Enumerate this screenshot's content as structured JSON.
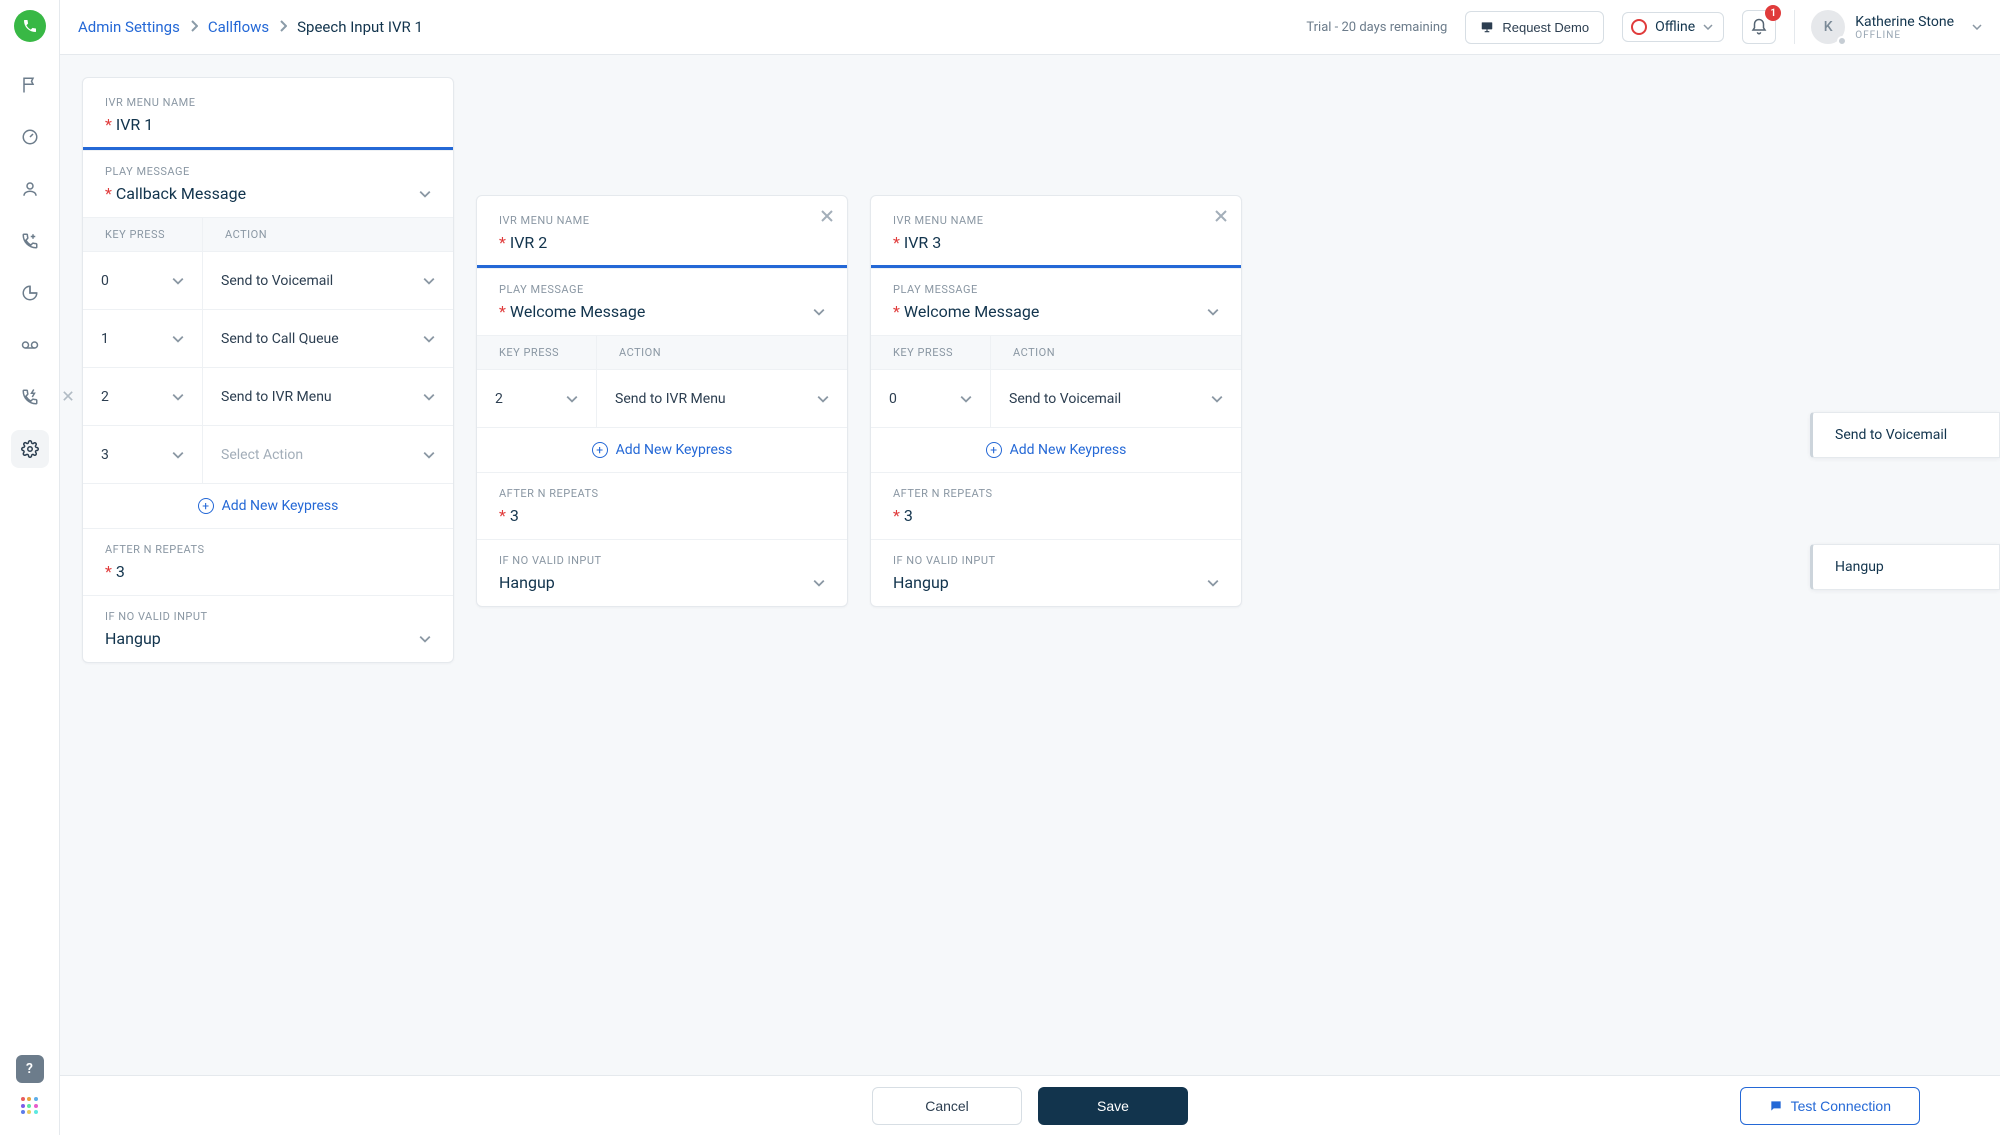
{
  "brand_color": "#38B845",
  "accent_color": "#2468D6",
  "breadcrumb": {
    "admin_settings": "Admin Settings",
    "callflows": "Callflows",
    "current": "Speech Input IVR 1"
  },
  "topbar": {
    "trial_text": "Trial - 20 days remaining",
    "request_demo": "Request Demo",
    "status_label": "Offline",
    "notif_count": "1",
    "user_name": "Katherine Stone",
    "user_status": "OFFLINE",
    "user_initial": "K"
  },
  "labels": {
    "ivr_menu_name": "IVR MENU NAME",
    "play_message": "PLAY MESSAGE",
    "key_press": "KEY PRESS",
    "action": "ACTION",
    "add_keypress": "Add New Keypress",
    "after_n_repeats": "AFTER N REPEATS",
    "if_no_valid_input": "IF NO VALID INPUT",
    "select_action_placeholder": "Select Action"
  },
  "ivr1": {
    "name": "IVR 1",
    "play_message": "Callback Message",
    "rows": [
      {
        "key": "0",
        "action": "Send to Voicemail",
        "removable": false,
        "placeholder": false
      },
      {
        "key": "1",
        "action": "Send to Call Queue",
        "removable": false,
        "placeholder": false
      },
      {
        "key": "2",
        "action": "Send to IVR Menu",
        "removable": true,
        "placeholder": false
      },
      {
        "key": "3",
        "action": "",
        "removable": false,
        "placeholder": true
      }
    ],
    "after_n_repeats": "3",
    "no_valid_input": "Hangup"
  },
  "ivr2": {
    "name": "IVR 2",
    "play_message": "Welcome Message",
    "rows": [
      {
        "key": "2",
        "action": "Send to IVR Menu"
      }
    ],
    "after_n_repeats": "3",
    "no_valid_input": "Hangup"
  },
  "ivr3": {
    "name": "IVR 3",
    "play_message": "Welcome Message",
    "rows": [
      {
        "key": "0",
        "action": "Send to Voicemail"
      }
    ],
    "after_n_repeats": "3",
    "no_valid_input": "Hangup"
  },
  "edge_chips": {
    "chip1": "Send to Voicemail",
    "chip2": "Hangup"
  },
  "footer": {
    "cancel": "Cancel",
    "save": "Save",
    "test_connection": "Test Connection"
  }
}
